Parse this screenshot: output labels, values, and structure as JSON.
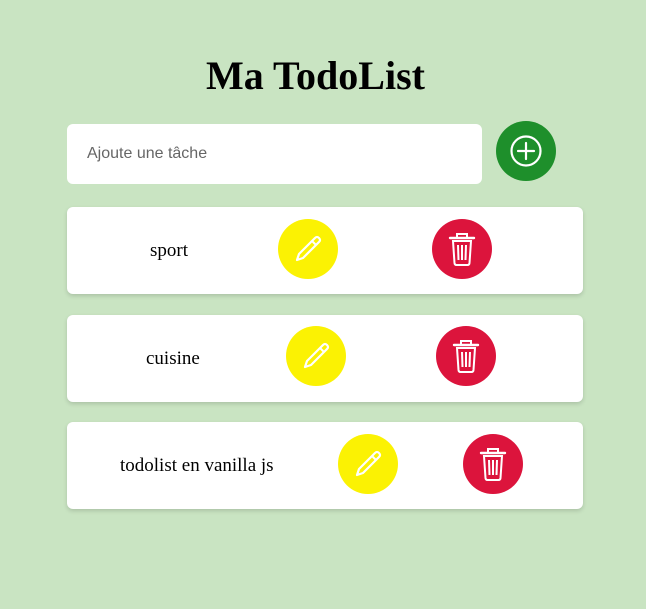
{
  "header": {
    "title": "Ma TodoList"
  },
  "input": {
    "placeholder": "Ajoute une tâche",
    "value": ""
  },
  "add_button": {
    "icon": "plus-circle-icon",
    "color": "#1e8f2b"
  },
  "tasks": [
    {
      "label": "sport"
    },
    {
      "label": "cuisine"
    },
    {
      "label": "todolist en vanilla js"
    }
  ],
  "colors": {
    "background": "#c9e4c2",
    "edit": "#fbf203",
    "delete": "#dc143c",
    "card": "#ffffff"
  }
}
